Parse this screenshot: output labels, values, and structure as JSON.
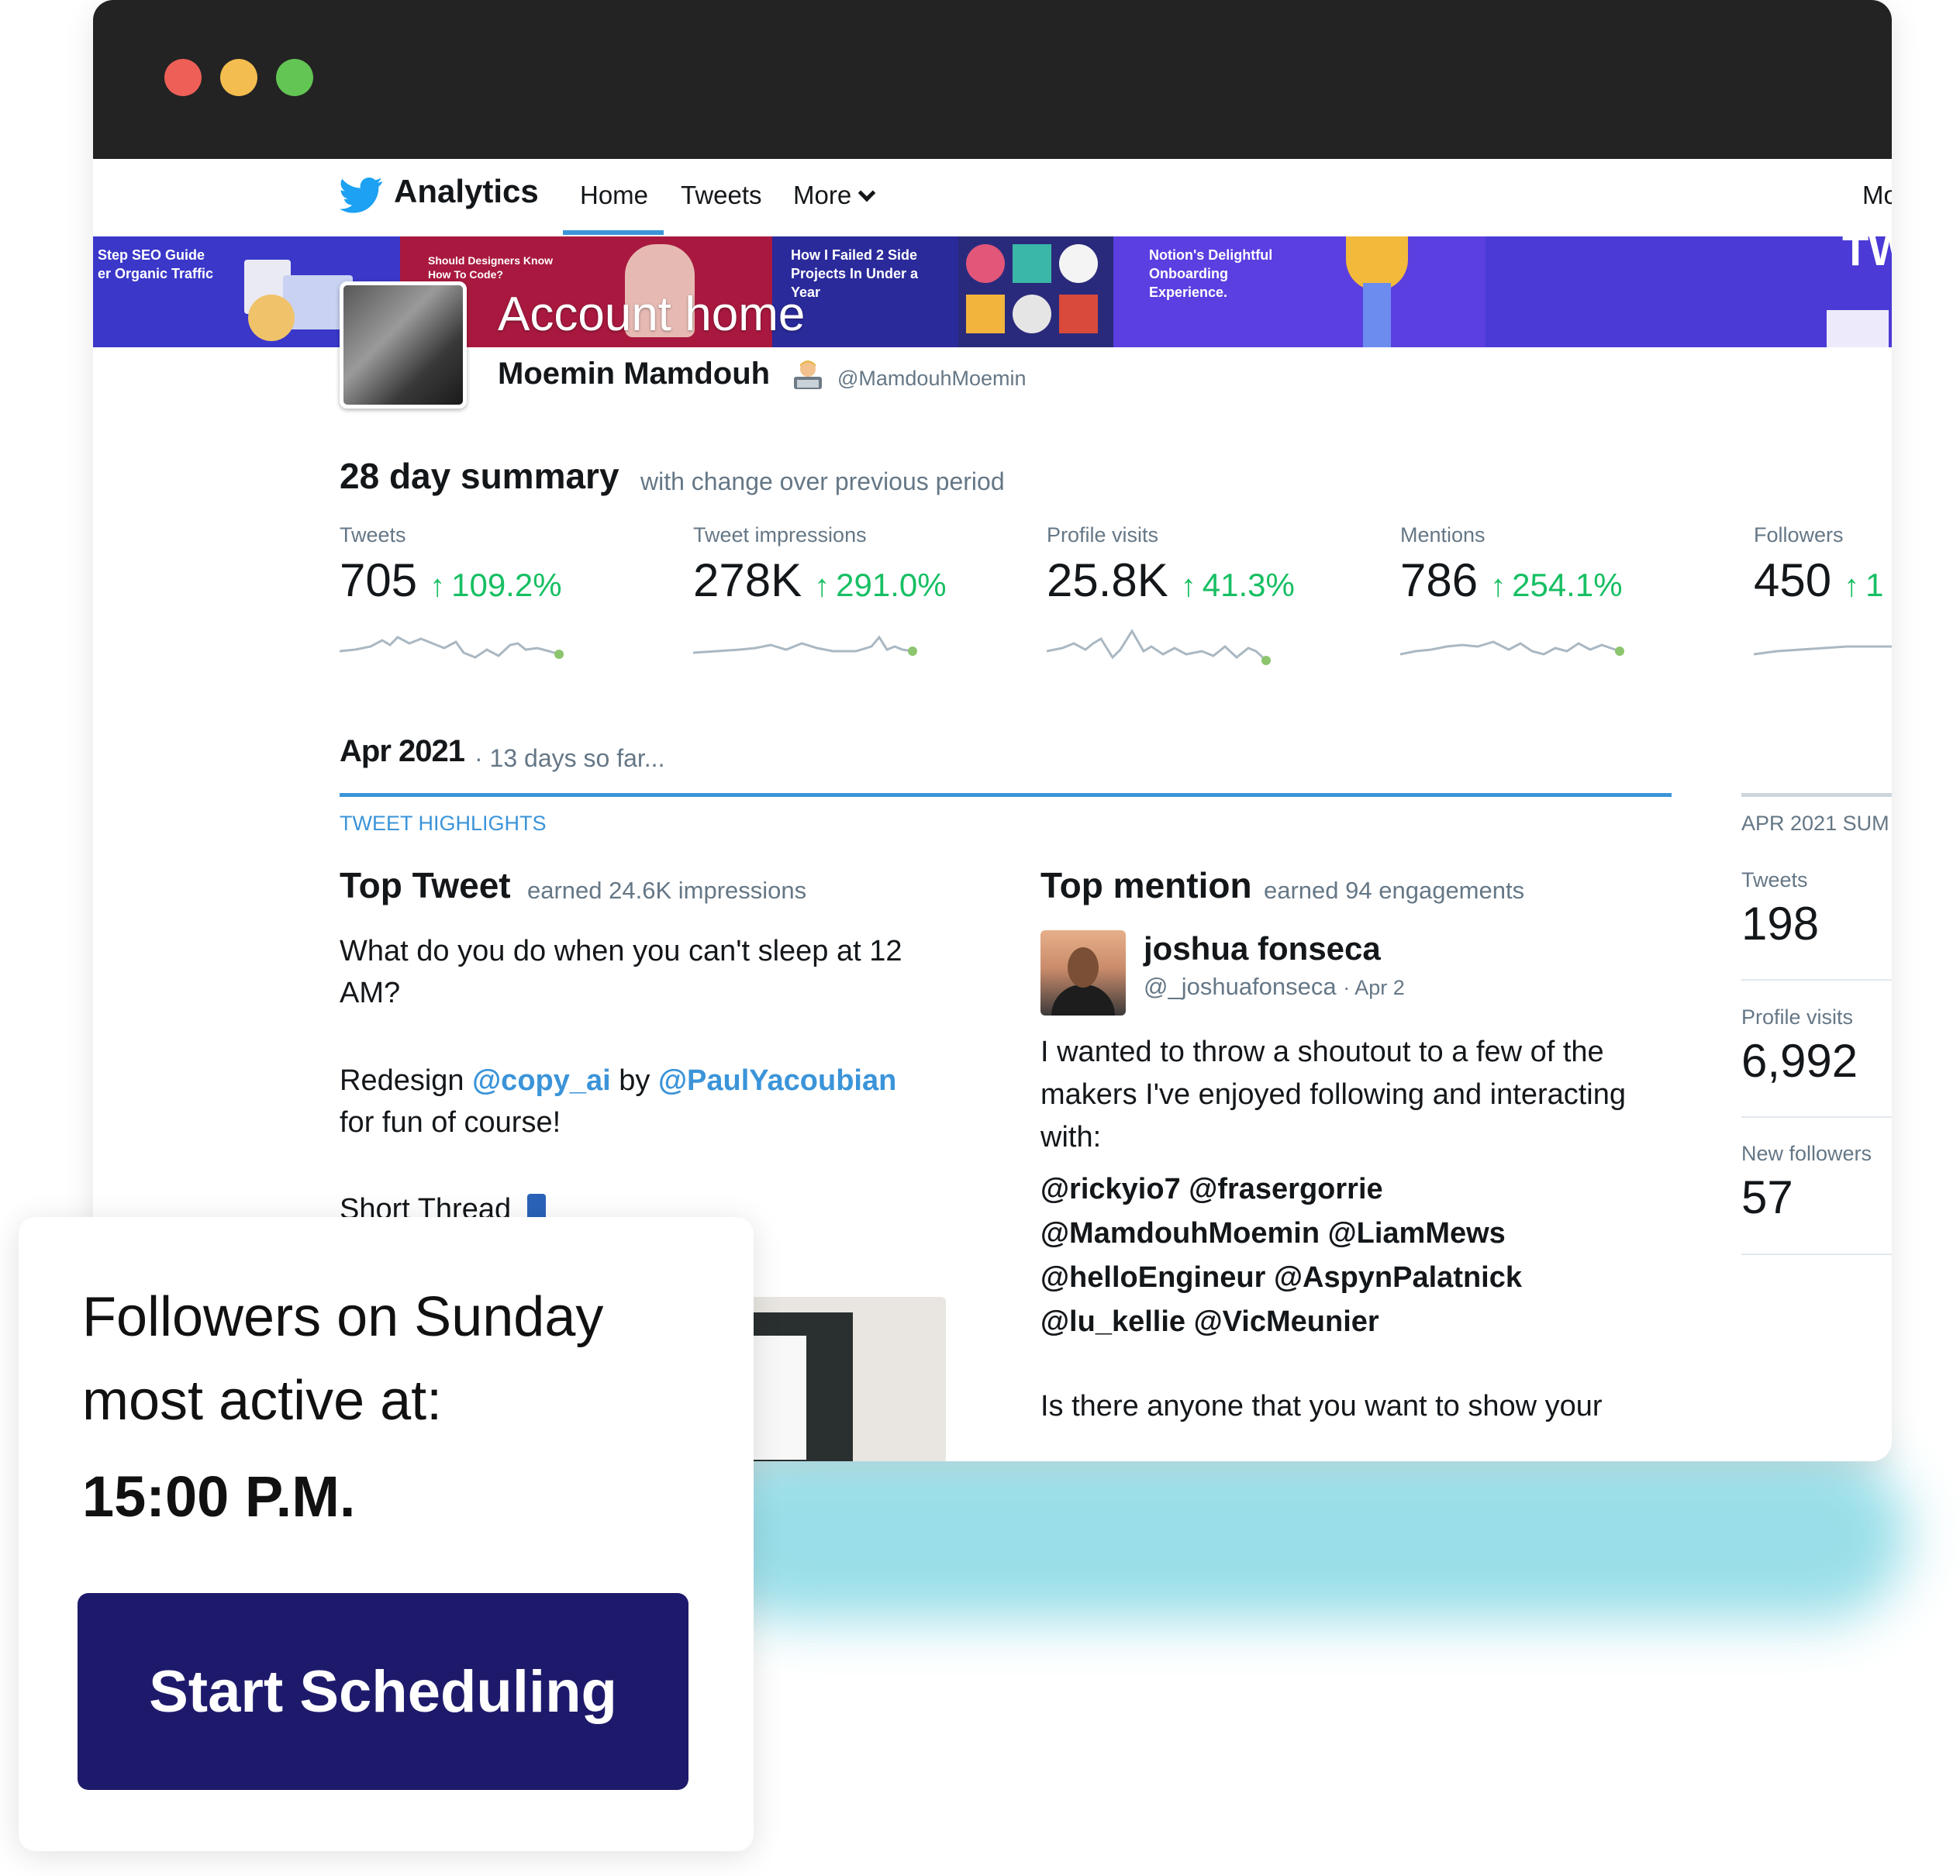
{
  "window": {
    "controls": [
      "close",
      "minimize",
      "maximize"
    ]
  },
  "nav": {
    "brand": "Analytics",
    "home": "Home",
    "tweets": "Tweets",
    "more": "More",
    "right_truncated": "Mo",
    "icons": {
      "logo": "twitter-bird-icon",
      "more": "chevron-down-icon"
    }
  },
  "banner": {
    "tiles": [
      "Step SEO Guide\ner Organic Traffic",
      "Should Designers Know\nHow To Code?",
      "How I Failed 2 Side\nProjects In Under a\nYear",
      "Notion's Delightful\nOnboarding\nExperience.",
      "TW"
    ]
  },
  "account": {
    "heading": "Account home",
    "name": "Moemin Mamdouh",
    "handle": "@MamdouhMoemin"
  },
  "summary": {
    "title": "28 day summary",
    "subtitle": "with change over previous period",
    "metrics": [
      {
        "label": "Tweets",
        "value": "705",
        "change": "109.2%"
      },
      {
        "label": "Tweet impressions",
        "value": "278K",
        "change": "291.0%"
      },
      {
        "label": "Profile visits",
        "value": "25.8K",
        "change": "41.3%"
      },
      {
        "label": "Mentions",
        "value": "786",
        "change": "254.1%"
      },
      {
        "label": "Followers",
        "value": "450",
        "change": "1"
      }
    ]
  },
  "month": {
    "title": "Apr 2021",
    "subtitle": "· 13 days so far...",
    "highlights_label": "TWEET HIGHLIGHTS"
  },
  "top_tweet": {
    "title": "Top Tweet",
    "subtitle": "earned 24.6K impressions",
    "line1": "What do you do when you can't sleep at 12 AM?",
    "redesign": "Redesign",
    "mention1": "@copy_ai",
    "by": "by",
    "mention2": "@PaulYacoubian",
    "fun": "for fun of course!",
    "thread": "Short Thread"
  },
  "top_mention": {
    "title": "Top mention",
    "subtitle": "earned 94 engagements",
    "name": "joshua fonseca",
    "handle": "@_joshuafonseca",
    "date": "· Apr 2",
    "text": "I wanted to throw a shoutout to a few of the makers I've enjoyed following and interacting with:",
    "mentions_line1": "@rickyio7 @frasergorrie",
    "mentions_line2": "@MamdouhMoemin @LiamMews",
    "mentions_line3": "@helloEngineur @AspynPalatnick",
    "mentions_line4": "@lu_kellie @VicMeunier",
    "last": "Is there anyone that you want to show your"
  },
  "side_summary": {
    "title": "APR 2021 SUM",
    "items": [
      {
        "label": "Tweets",
        "value": "198"
      },
      {
        "label": "Profile visits",
        "value": "6,992"
      },
      {
        "label": "New followers",
        "value": "57"
      }
    ]
  },
  "card": {
    "line1": "Followers on Sunday",
    "line2": "most active at:",
    "time": "15:00 P.M.",
    "cta": "Start Scheduling"
  },
  "colors": {
    "accent_blue": "#3b94d9",
    "positive_green": "#17bf63",
    "cta_bg": "#1e1a6b",
    "titlebar": "#232323"
  }
}
